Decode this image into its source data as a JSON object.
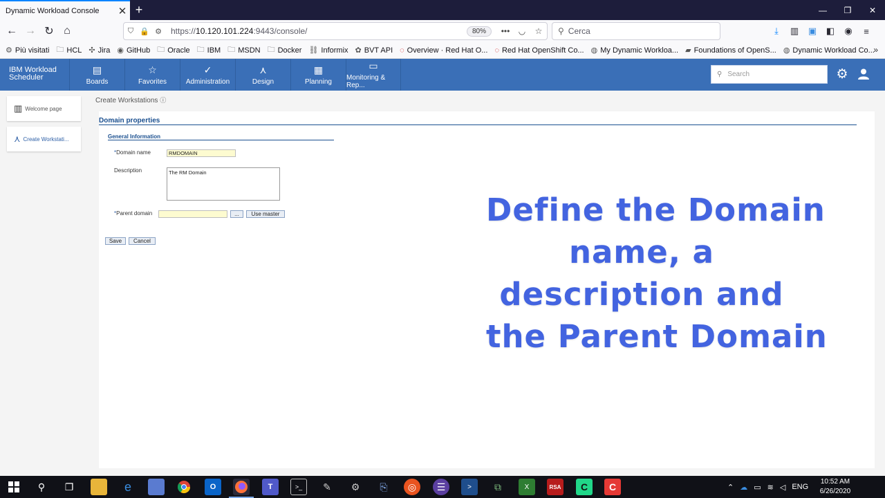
{
  "browser": {
    "tab_title": "Dynamic Workload Console",
    "url_prefix": "https://",
    "url_host": "10.120.101.224",
    "url_rest": ":9443/console/",
    "zoom": "80%",
    "search_placeholder": "Cerca"
  },
  "bookmarks": [
    {
      "label": "Più visitati",
      "icon": "gear-icon"
    },
    {
      "label": "HCL",
      "icon": "folder-icon"
    },
    {
      "label": "Jira",
      "icon": "jira-icon"
    },
    {
      "label": "GitHub",
      "icon": "github-icon"
    },
    {
      "label": "Oracle",
      "icon": "folder-icon"
    },
    {
      "label": "IBM",
      "icon": "folder-icon"
    },
    {
      "label": "MSDN",
      "icon": "folder-icon"
    },
    {
      "label": "Docker",
      "icon": "folder-icon"
    },
    {
      "label": "Informix",
      "icon": "link-icon"
    },
    {
      "label": "BVT API",
      "icon": "bug-icon"
    },
    {
      "label": "Overview · Red Hat O...",
      "icon": "redhat-icon"
    },
    {
      "label": "Red Hat OpenShift Co...",
      "icon": "redhat-icon"
    },
    {
      "label": "My Dynamic Workloa...",
      "icon": "globe-icon"
    },
    {
      "label": "Foundations of OpenS...",
      "icon": "book-icon"
    },
    {
      "label": "Dynamic Workload Co...",
      "icon": "globe-icon"
    }
  ],
  "app": {
    "brand_line1": "IBM Workload",
    "brand_line2": "Scheduler",
    "menu": [
      {
        "label": "Boards",
        "icon": "boards-icon"
      },
      {
        "label": "Favorites",
        "icon": "star-icon"
      },
      {
        "label": "Administration",
        "icon": "admin-icon"
      },
      {
        "label": "Design",
        "icon": "compass-icon"
      },
      {
        "label": "Planning",
        "icon": "calendar-icon"
      },
      {
        "label": "Monitoring & Rep...",
        "icon": "monitor-icon"
      }
    ],
    "search_placeholder": "Search"
  },
  "left_rail": [
    {
      "label": "Welcome page",
      "icon": "map-icon",
      "active": false
    },
    {
      "label": "Create Workstati...",
      "icon": "compass-icon",
      "active": true
    }
  ],
  "page": {
    "breadcrumb": "Create Workstations",
    "section_title": "Domain properties",
    "sub_title": "General Information",
    "domain_name_label": "Domain name",
    "domain_name_value": "RMDOMAIN",
    "description_label": "Description",
    "description_value": "The RM Domain",
    "parent_domain_label": "Parent domain",
    "parent_domain_value": "",
    "browse_label": "...",
    "use_master_label": "Use master",
    "save_label": "Save",
    "cancel_label": "Cancel"
  },
  "overlay": {
    "line1": "Define the Domain",
    "line2": "name, a",
    "line3": "description and",
    "line4": "the Parent Domain",
    "color": "#4364e0"
  },
  "taskbar": {
    "language": "ENG",
    "time": "10:52 AM",
    "date": "6/26/2020"
  },
  "colors": {
    "header": "#3a6fb7",
    "accent": "#1a4f8f",
    "field_fill": "#fdfbd0"
  }
}
